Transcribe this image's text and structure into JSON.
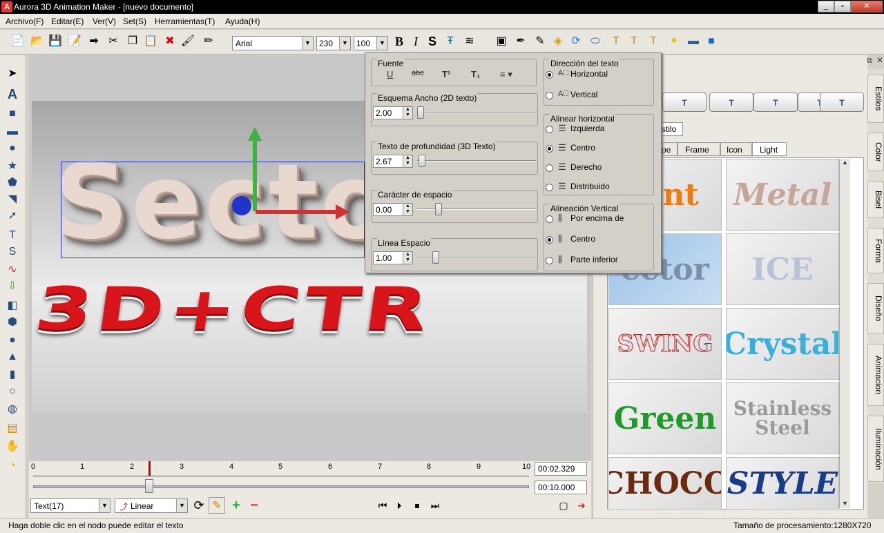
{
  "window": {
    "title": "Aurora 3D Animation Maker - [nuevo documento]",
    "app_icon": "A",
    "minimize": "_",
    "restore": "▫",
    "close": "✕"
  },
  "menu": [
    "Archivo(F)",
    "Editar(E)",
    "Ver(V)",
    "Set(S)",
    "Herramientas(T)",
    "Ayuda(H)"
  ],
  "toolbar": {
    "font": "Arial",
    "size_a": "230",
    "size_b": "100",
    "bold": "B",
    "italic": "I",
    "strike": "S"
  },
  "canvas": {
    "main_text": "Secto",
    "red_text": "3D+CTR"
  },
  "timeline": {
    "ticks": [
      "0",
      "1",
      "2",
      "3",
      "4",
      "5",
      "6",
      "7",
      "8",
      "9",
      "10"
    ],
    "current_time": "00:02.329",
    "total_time": "00:10.000",
    "object": "Text(17)",
    "interpolation": "Linear"
  },
  "status": {
    "left": "Haga doble clic en el nodo puede editar el texto",
    "right": "Tamaño de procesamiento:1280X720"
  },
  "popup": {
    "font_group": "Fuente",
    "font_icons": [
      "U",
      "abc",
      "T¹",
      "T₁",
      "≡ ▾"
    ],
    "width_group": "Esquema Ancho (2D texto)",
    "width_value": "2.00",
    "depth_group": "Texto de profundidad (3D Texto)",
    "depth_value": "2.67",
    "spacing_group": "Carácter de espacio",
    "spacing_value": "0.00",
    "line_group": "Línea Espacio",
    "line_value": "1.00",
    "direction_group": "Dirección del texto",
    "direction_options": [
      "Horizontal",
      "Vertical"
    ],
    "halign_group": "Alinear horizontal",
    "halign_options": [
      "Izquierda",
      "Centro",
      "Derecho",
      "Distribuido"
    ],
    "valign_group": "Alineación Vertical",
    "valign_options": [
      "Por encima de",
      "Centro",
      "Parte inferior"
    ]
  },
  "rightpanel": {
    "tab_estilo": "stilo",
    "subtabs": [
      "pe",
      "Frame",
      "Icon",
      "Light"
    ],
    "styles": [
      "aint",
      "Metal",
      "ector",
      "ICE",
      "SWING",
      "Crystal",
      "Green",
      "Stainless Steel",
      "CHOCO",
      "STYLE"
    ]
  },
  "side_tabs": [
    "Estilos",
    "Color",
    "Bisel",
    "Forma",
    "Diseño",
    "Animacion",
    "Iluminación"
  ]
}
